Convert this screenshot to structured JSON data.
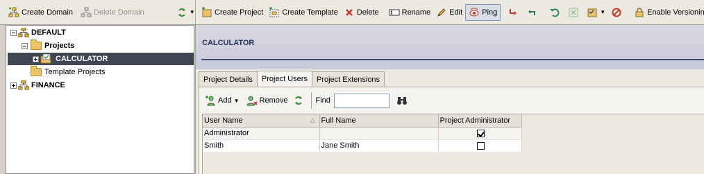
{
  "left_toolbar": {
    "create_domain": "Create Domain",
    "delete_domain": "Delete Domain"
  },
  "tree": {
    "nodes": [
      {
        "label": "DEFAULT"
      },
      {
        "label": "Projects"
      },
      {
        "label": "CALCULATOR"
      },
      {
        "label": "Template Projects"
      },
      {
        "label": "FINANCE"
      }
    ]
  },
  "main_toolbar": {
    "create_project": "Create Project",
    "create_template": "Create Template",
    "delete": "Delete",
    "rename": "Rename",
    "edit": "Edit",
    "ping": "Ping",
    "enable_versioning": "Enable Versioning"
  },
  "content": {
    "title": "CALCULATOR",
    "tabs": [
      {
        "label": "Project Details"
      },
      {
        "label": "Project Users"
      },
      {
        "label": "Project Extensions"
      }
    ],
    "active_tab": "Project Users"
  },
  "grid_toolbar": {
    "add": "Add",
    "remove": "Remove",
    "find_label": "Find",
    "find_value": ""
  },
  "table": {
    "columns": [
      "User Name",
      "Full Name",
      "Project Administrator"
    ],
    "rows": [
      {
        "user_name": "Administrator",
        "full_name": "",
        "project_admin": true
      },
      {
        "user_name": "Smith",
        "full_name": "Jane Smith",
        "project_admin": false
      }
    ]
  },
  "colors": {
    "selection": "#3f4753",
    "header_title": "#1f2f57",
    "delete_red": "#c0392b"
  }
}
